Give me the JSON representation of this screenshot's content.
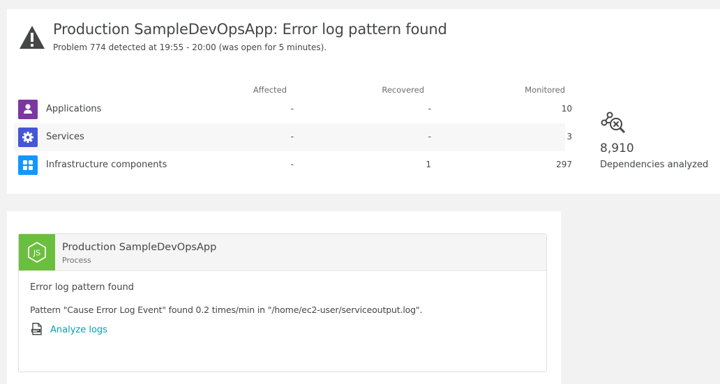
{
  "problem": {
    "title": "Production SampleDevOpsApp: Error log pattern found",
    "subtitle": "Problem 774 detected at 19:55 - 20:00 (was open for 5 minutes)."
  },
  "impact_table": {
    "headers": [
      "Affected",
      "Recovered",
      "Monitored"
    ],
    "rows": [
      {
        "label": "Applications",
        "icon": "user-icon",
        "color": "#7c38a1",
        "affected": "-",
        "recovered": "-",
        "monitored": "10"
      },
      {
        "label": "Services",
        "icon": "gear-icon",
        "color": "#4556d7",
        "affected": "-",
        "recovered": "-",
        "monitored": "3"
      },
      {
        "label": "Infrastructure components",
        "icon": "grid-icon",
        "color": "#1496ff",
        "affected": "-",
        "recovered": "1",
        "monitored": "297"
      }
    ]
  },
  "dependencies": {
    "count": "8,910",
    "label": "Dependencies analyzed",
    "icon": "dependency-search-icon"
  },
  "event": {
    "process_name": "Production SampleDevOpsApp",
    "process_type": "Process",
    "process_icon": "nodejs-icon",
    "process_color": "#6bbf3f",
    "title": "Error log pattern found",
    "description": "Pattern \"Cause Error Log Event\" found 0.2 times/min in \"/home/ec2-user/serviceoutput.log\".",
    "link_label": "Analyze logs",
    "link_icon": "log-file-icon",
    "link_color": "#00a1b2"
  }
}
